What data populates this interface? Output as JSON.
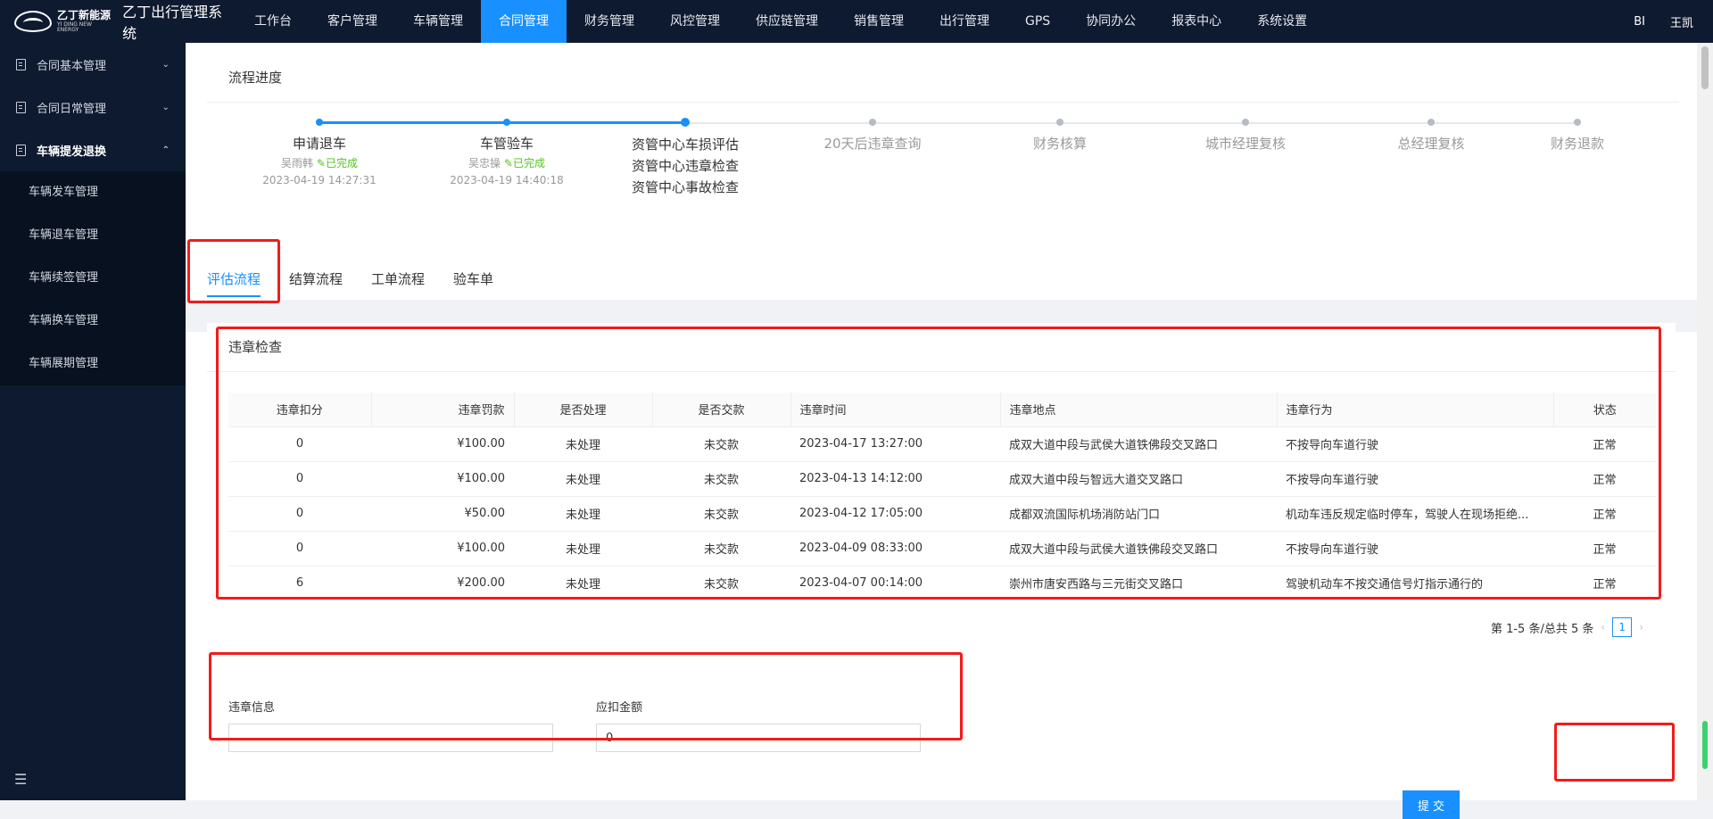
{
  "app": {
    "brand_cn": "乙丁新能源",
    "brand_en": "YI DING NEW ENERGY",
    "title": "乙丁出行管理系统"
  },
  "nav": [
    "工作台",
    "客户管理",
    "车辆管理",
    "合同管理",
    "财务管理",
    "风控管理",
    "供应链管理",
    "销售管理",
    "出行管理",
    "GPS",
    "协同办公",
    "报表中心",
    "系统设置"
  ],
  "top_right": {
    "bi": "BI",
    "user": "王凯"
  },
  "sidebar": {
    "groups": [
      {
        "label": "合同基本管理",
        "chev": "⌄"
      },
      {
        "label": "合同日常管理",
        "chev": "⌄"
      },
      {
        "label": "车辆提发退换",
        "chev": "⌃"
      }
    ],
    "sub_items": [
      "车辆发车管理",
      "车辆退车管理",
      "车辆续签管理",
      "车辆换车管理",
      "车辆展期管理"
    ],
    "collapse_icon": "☰"
  },
  "progress": {
    "title": "流程进度",
    "steps": [
      {
        "name": "申请退车",
        "who": "吴雨韩",
        "status": "已完成",
        "time": "2023-04-19 14:27:31"
      },
      {
        "name": "车管验车",
        "who": "吴忠操",
        "status": "已完成",
        "time": "2023-04-19 14:40:18"
      },
      {
        "name": "资管中心车损评估",
        "name2": "资管中心违章检查",
        "name3": "资管中心事故检查"
      },
      {
        "name": "20天后违章查询"
      },
      {
        "name": "财务核算"
      },
      {
        "name": "城市经理复核"
      },
      {
        "name": "总经理复核"
      },
      {
        "name": "财务退款"
      }
    ]
  },
  "tabs": [
    "评估流程",
    "结算流程",
    "工单流程",
    "验车单"
  ],
  "violation": {
    "title": "违章检查",
    "columns": [
      "违章扣分",
      "违章罚款",
      "是否处理",
      "是否交款",
      "违章时间",
      "违章地点",
      "违章行为",
      "状态"
    ],
    "rows": [
      [
        "0",
        "¥100.00",
        "未处理",
        "未交款",
        "2023-04-17 13:27:00",
        "成双大道中段与武侯大道铁佛段交叉路口",
        "不按导向车道行驶",
        "正常"
      ],
      [
        "0",
        "¥100.00",
        "未处理",
        "未交款",
        "2023-04-13 14:12:00",
        "成双大道中段与智远大道交叉路口",
        "不按导向车道行驶",
        "正常"
      ],
      [
        "0",
        "¥50.00",
        "未处理",
        "未交款",
        "2023-04-12 17:05:00",
        "成都双流国际机场消防站门口",
        "机动车违反规定临时停车，驾驶人在现场拒绝...",
        "正常"
      ],
      [
        "0",
        "¥100.00",
        "未处理",
        "未交款",
        "2023-04-09 08:33:00",
        "成双大道中段与武侯大道铁佛段交叉路口",
        "不按导向车道行驶",
        "正常"
      ],
      [
        "6",
        "¥200.00",
        "未处理",
        "未交款",
        "2023-04-07 00:14:00",
        "崇州市唐安西路与三元街交叉路口",
        "驾驶机动车不按交通信号灯指示通行的",
        "正常"
      ]
    ],
    "pagination": {
      "summary": "第 1-5 条/总共 5 条",
      "page": "1",
      "prev": "‹",
      "next": "›"
    }
  },
  "form": {
    "info_label": "违章信息",
    "info_value": "",
    "amount_label": "应扣金额",
    "amount_value": "0"
  },
  "submit_label": "提 交"
}
